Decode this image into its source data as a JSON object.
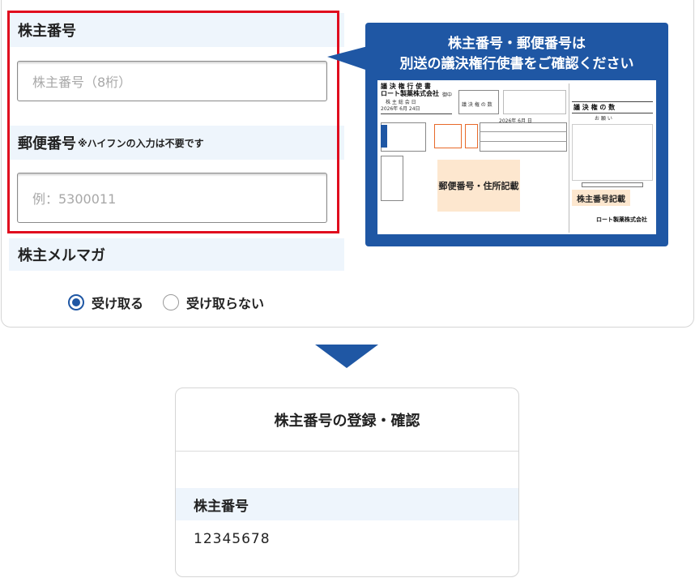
{
  "form": {
    "shareholder_number_label": "株主番号",
    "shareholder_number_placeholder": "株主番号（8桁）",
    "postal_code_label": "郵便番号",
    "postal_code_note": "※ハイフンの入力は不要です",
    "postal_code_placeholder": "例：5300011",
    "newsletter_label": "株主メルマガ",
    "newsletter_options": [
      "受け取る",
      "受け取らない"
    ],
    "newsletter_selected": "受け取る"
  },
  "guide_panel": {
    "heading_line1": "株主番号・郵便番号は",
    "heading_line2": "別送の議決権行使書をご確認ください",
    "document": {
      "title": "議 決 権 行 使 書",
      "company": "ロート製薬株式会社",
      "honorific": "御中",
      "meeting": "株 主 総 会 日",
      "date1": "2026年 6月 24日",
      "votes_label": "議 決 権 の 数",
      "date2": "2026年 6月 日",
      "postal_address_note": "郵便番号・住所記載",
      "shareholder_number_note": "株主番号記載",
      "right_heading": "議 決 権 の 数",
      "right_notice": "お 願 い",
      "footer_company": "ロート製薬株式会社"
    }
  },
  "confirm": {
    "title": "株主番号の登録・確認",
    "label": "株主番号",
    "value": "12345678"
  },
  "colors": {
    "accent_blue": "#1f57a4",
    "highlight_red": "#e00b1e",
    "label_band": "#eef5fc",
    "peach": "#fde7cf"
  }
}
